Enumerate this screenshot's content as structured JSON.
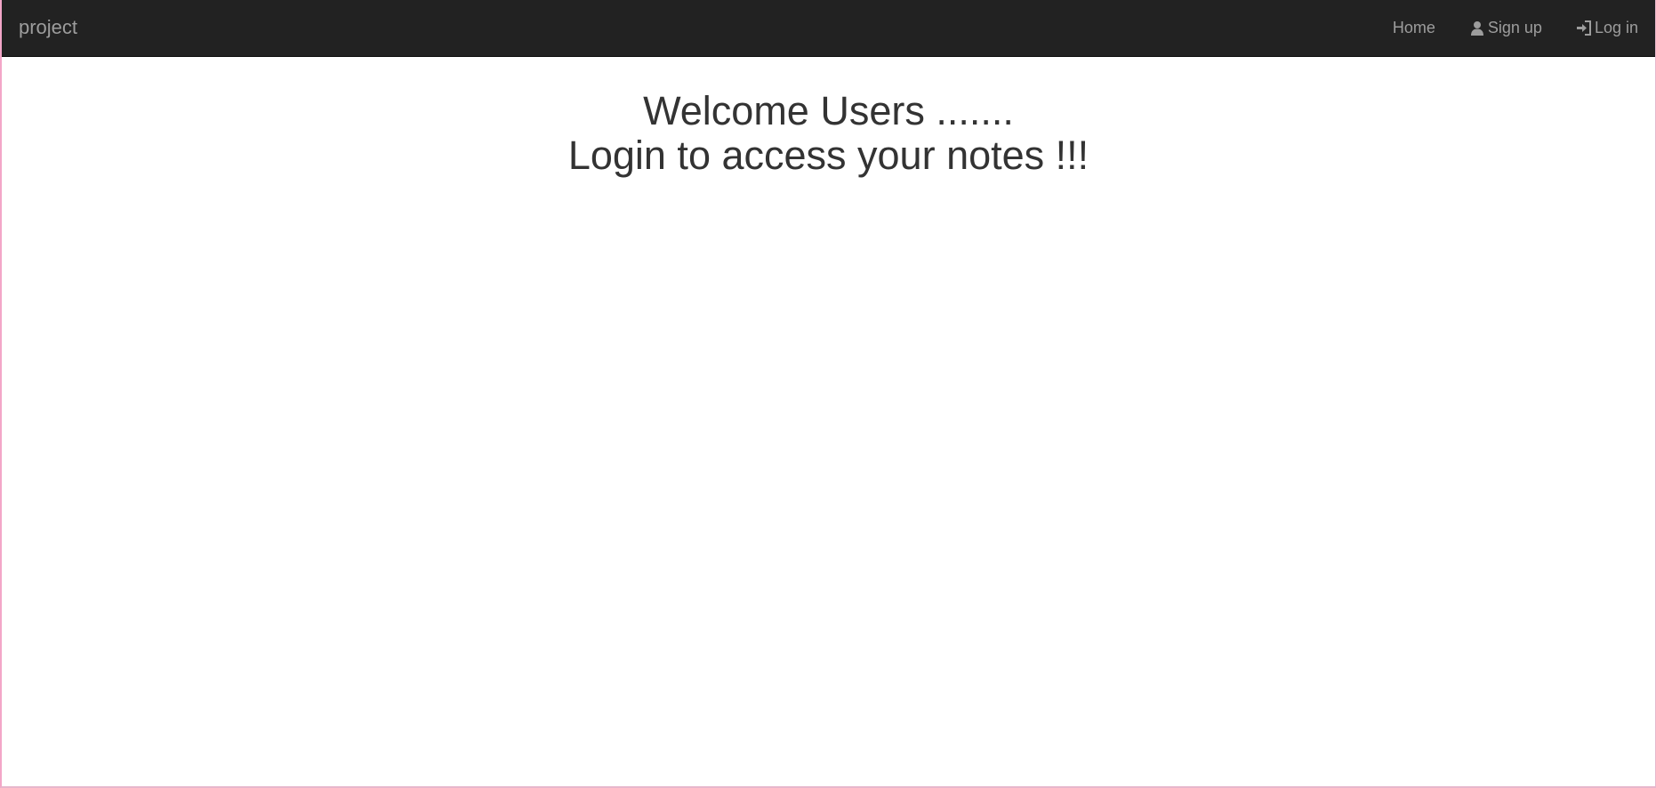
{
  "navbar": {
    "brand": "project",
    "links": {
      "home": {
        "label": "Home"
      },
      "signup": {
        "label": "Sign up",
        "icon": "user-icon"
      },
      "login": {
        "label": "Log in",
        "icon": "log-in-icon"
      }
    },
    "background": "#222222",
    "link_color": "#9d9d9d"
  },
  "main": {
    "heading_line_1": "Welcome Users .......",
    "heading_line_2": "Login to access your notes !!!"
  }
}
